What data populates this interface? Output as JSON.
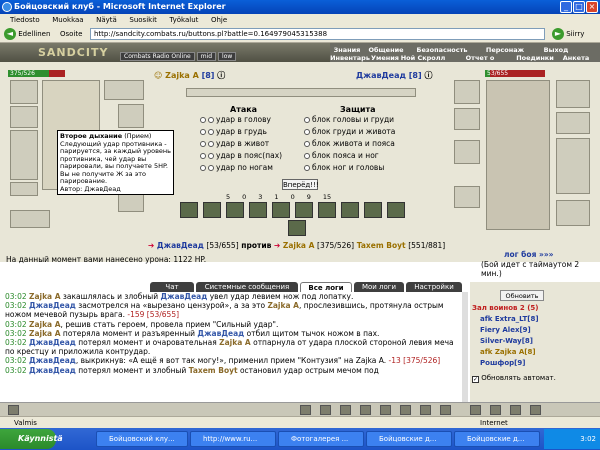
{
  "window": {
    "title": "Бойцовский клуб - Microsoft Internet Explorer"
  },
  "menu": [
    "Tiedosto",
    "Muokkaa",
    "Näytä",
    "Suosikit",
    "Työkalut",
    "Ohje"
  ],
  "nav": {
    "back_label": "Edellinen",
    "address_label": "Osoite",
    "url": "http://sandcity.combats.ru/buttons.pl?battle=0.164979045315388",
    "go_label": "Siirry"
  },
  "game": {
    "logo": "SANDCITY",
    "radio": [
      "Combats Radio Online",
      "mid",
      "low"
    ],
    "top_menu_row1": [
      "Знания",
      "Общение",
      "Безопасность",
      "Персонаж",
      "Выход"
    ],
    "top_menu_row2": [
      "Инвентарь",
      "Умения",
      "Ной Скролл",
      "Отчет о переводах",
      "Поединки",
      "Анкета"
    ],
    "left_fighter": {
      "name": "Zajka A",
      "level": "[8]",
      "hp": "375/526",
      "hp_fraction": 0.713
    },
    "right_fighter": {
      "name": "ДжавДеад",
      "level": "[8]",
      "hp": "53/655",
      "hp_fraction": 0.081
    },
    "tooltip": {
      "title": "Второе дыхание",
      "type": "(Прием)",
      "body": "Следующий удар противника - парируется, за каждый уровень противника, чей удар вы парировали, вы получаете 5HP. Вы не получите Ж за это парирование.",
      "author": "Автор: ДжавДеад"
    },
    "attack_title": "Атака",
    "defense_title": "Защита",
    "attack_options": [
      "удар в голову",
      "удар в грудь",
      "удар в живот",
      "удар в пояс(пах)",
      "удар по ногам"
    ],
    "defense_options": [
      "блок головы и груди",
      "блок груди и живота",
      "блок живота и пояса",
      "блок пояса и ног",
      "блок ног и головы"
    ],
    "forward_label": "Вперёд!!!",
    "counters": [
      "5",
      "0",
      "3",
      "1",
      "0",
      "9",
      "15"
    ],
    "vs": {
      "left": "ДжавДеад",
      "left_hp": "[53/655]",
      "against": "против",
      "right1": "Zajka A",
      "right1_hp": "[375/526]",
      "right2": "Taxem Boyt",
      "right2_hp": "[551/881]"
    },
    "damage_text": "На данный момент вами нанесено урона: 1122 HP.",
    "log_link": "лог боя »»»",
    "timeout_text": "(Бой идет с таймаутом 2 мин.)"
  },
  "tabs": [
    "Чат",
    "Системные сообщения",
    "Все логи",
    "Мои логи",
    "Настройки"
  ],
  "chat": [
    {
      "time": "03:02",
      "a": "Zajka A",
      "text": " закашлялась и злобный ",
      "b": "ДжавДеад",
      "text2": " увел удар левием нож под лопатку."
    },
    {
      "time": "03:02",
      "a": "ДжавДеад",
      "text": " засмотрелся на «вырезано цензурой», а за это ",
      "b": "Zajka A",
      "text2": ", прослезившись, протянула острым ножом мечевой пузырь врага. ",
      "dmg": "-159 [53/655]"
    },
    {
      "time": "03:02",
      "a": "Zajka A",
      "text": ", решив стать героем, провела прием ",
      "b": "",
      "text2": "\"Сильный удар\"."
    },
    {
      "time": "03:02",
      "a": "Zajka A",
      "text": " потеряла момент и разъяренный ",
      "b": "ДжавДеад",
      "text2": " отбил щитом тычок ножом в пах."
    },
    {
      "time": "03:02",
      "a": "ДжавДеад",
      "text": " потерял момент и очаровательная ",
      "b": "Zajka A",
      "text2": " отпарнула от удара плоской стороной левия меча по крестцу и приложила контрудар."
    },
    {
      "time": "03:02",
      "a": "ДжавДеад",
      "text": ", выкрикнув: «А ещё я вот так могу!», применил прием ",
      "b": "",
      "text2": "\"Контузия\" на Zajka A. ",
      "dmg": "-13 [375/526]"
    },
    {
      "time": "03:02",
      "a": "ДжавДеад",
      "text": " потерял момент и злобный ",
      "b": "Taxem Boyt",
      "text2": " остановил удар острым мечом под"
    }
  ],
  "right_panel": {
    "refresh_label": "Обновить",
    "room_title": "Зал воинов 2 (5)",
    "players": [
      "afk Extra_LT[8]",
      "Fiery Alex[9]",
      "Silver-Way[8]",
      "afk Zajka A[8]",
      "Рошфор[9]"
    ],
    "auto_update_label": "Обновлять автомат."
  },
  "status": {
    "text": "Valmis",
    "zone": "Internet"
  },
  "taskbar": {
    "start_label": "Käynnistä",
    "tasks": [
      "Бойцовский клу...",
      "http://www.ru...",
      "Фотогалерея ...",
      "Бойцовские д...",
      "Бойцовские д..."
    ],
    "clock": "3:02"
  },
  "colors": {
    "hp_green": "#2e8f2e",
    "title_blue": "#0a5fd8",
    "taskbar_blue": "#1d54c7"
  }
}
